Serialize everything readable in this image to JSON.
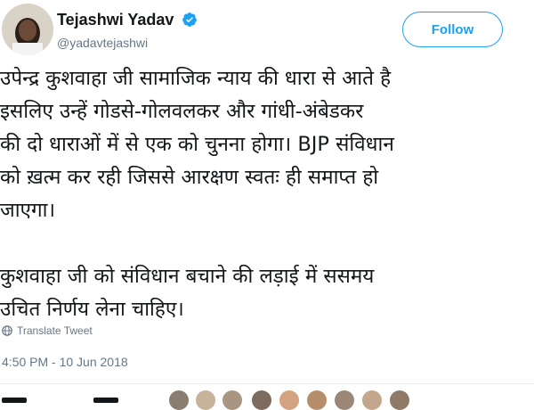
{
  "user": {
    "name": "Tejashwi Yadav",
    "handle": "@yadavtejashwi",
    "verified": true
  },
  "follow_label": "Follow",
  "tweet_lines": [
    "उपेन्द्र कुशवाहा जी सामाजिक न्याय की धारा से आते है",
    "इसलिए उन्हें गोडसे-गोलवलकर और गांधी-अंबेडकर",
    "की दो धाराओं में से एक को चुनना होगा। BJP संविधान",
    "को ख़त्म कर रही जिससे आरक्षण स्वतः ही समाप्त हो",
    "जाएगा।",
    "",
    "कुशवाहा जी को संविधान बचाने की लड़ाई में ससमय",
    "उचित निर्णय लेना चाहिए।"
  ],
  "translate_label": "Translate Tweet",
  "timestamp": "4:50 PM - 10 Jun 2018",
  "colors": {
    "accent": "#1da1f2",
    "text": "#14171a",
    "muted": "#657786"
  },
  "icons": {
    "verified": "verified-badge-icon",
    "translate": "globe-icon"
  }
}
